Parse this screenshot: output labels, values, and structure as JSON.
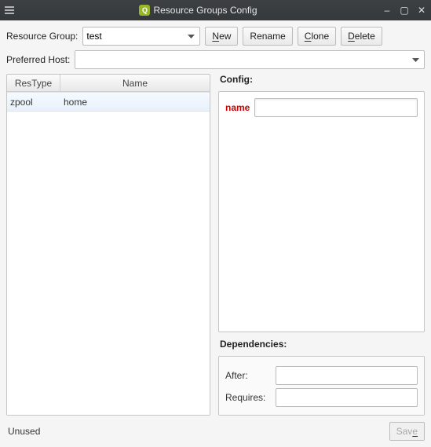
{
  "window": {
    "title": "Resource Groups Config"
  },
  "titlebar": {
    "minimize": "–",
    "maximize": "▢",
    "close": "✕"
  },
  "labels": {
    "resource_group": "Resource Group:",
    "preferred_host": "Preferred Host:",
    "config": "Config:",
    "dependencies": "Dependencies:",
    "after": "After:",
    "requires": "Requires:"
  },
  "buttons": {
    "new": "New",
    "new_u": "N",
    "rename": "Rename",
    "clone": "Clone",
    "clone_u": "C",
    "delete": "Delete",
    "delete_u": "D",
    "save": "Save",
    "save_u": "e"
  },
  "rg_select": {
    "value": "test",
    "options": [
      "test"
    ]
  },
  "host_select": {
    "value": "",
    "options": [
      ""
    ]
  },
  "table": {
    "cols": {
      "restype": "ResType",
      "name": "Name"
    },
    "rows": [
      {
        "restype": "zpool",
        "name": "home",
        "selected": true
      }
    ]
  },
  "config": {
    "name_label": "name",
    "name_value": ""
  },
  "deps": {
    "after_value": "",
    "requires_value": ""
  },
  "status": {
    "text": "Unused"
  }
}
